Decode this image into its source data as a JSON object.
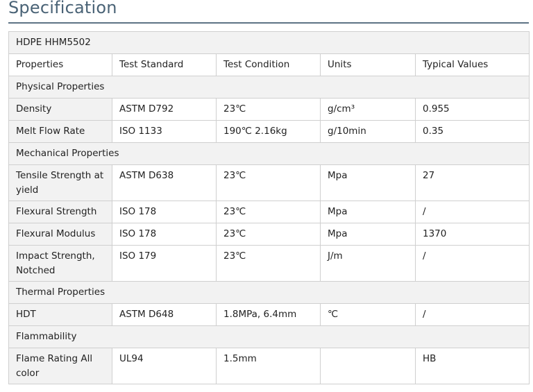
{
  "page": {
    "title": "Specification"
  },
  "table": {
    "product": "HDPE HHM5502",
    "headers": [
      "Properties",
      "Test Standard",
      "Test Condition",
      "Units",
      "Typical Values"
    ],
    "sections": [
      {
        "name": "Physical Properties",
        "rows": [
          [
            "Density",
            "ASTM D792",
            "23℃",
            "g/cm³",
            "0.955"
          ],
          [
            "Melt Flow Rate",
            "ISO 1133",
            "190℃ 2.16kg",
            "g/10min",
            "0.35"
          ]
        ]
      },
      {
        "name": "Mechanical Properties",
        "rows": [
          [
            "Tensile Strength at yield",
            "ASTM D638",
            "23℃",
            "Mpa",
            "27"
          ],
          [
            "Flexural Strength",
            "ISO 178",
            "23℃",
            "Mpa",
            "/"
          ],
          [
            "Flexural Modulus",
            "ISO 178",
            "23℃",
            "Mpa",
            "1370"
          ],
          [
            "Impact Strength, Notched",
            "ISO 179",
            "23℃",
            "J/m",
            "/"
          ]
        ]
      },
      {
        "name": "Thermal Properties",
        "rows": [
          [
            "HDT",
            "ASTM D648",
            "1.8MPa, 6.4mm",
            "℃",
            "/"
          ]
        ]
      },
      {
        "name": "Flammability",
        "rows": [
          [
            "Flame Rating All color",
            "UL94",
            "1.5mm",
            "",
            "HB"
          ]
        ]
      }
    ]
  }
}
